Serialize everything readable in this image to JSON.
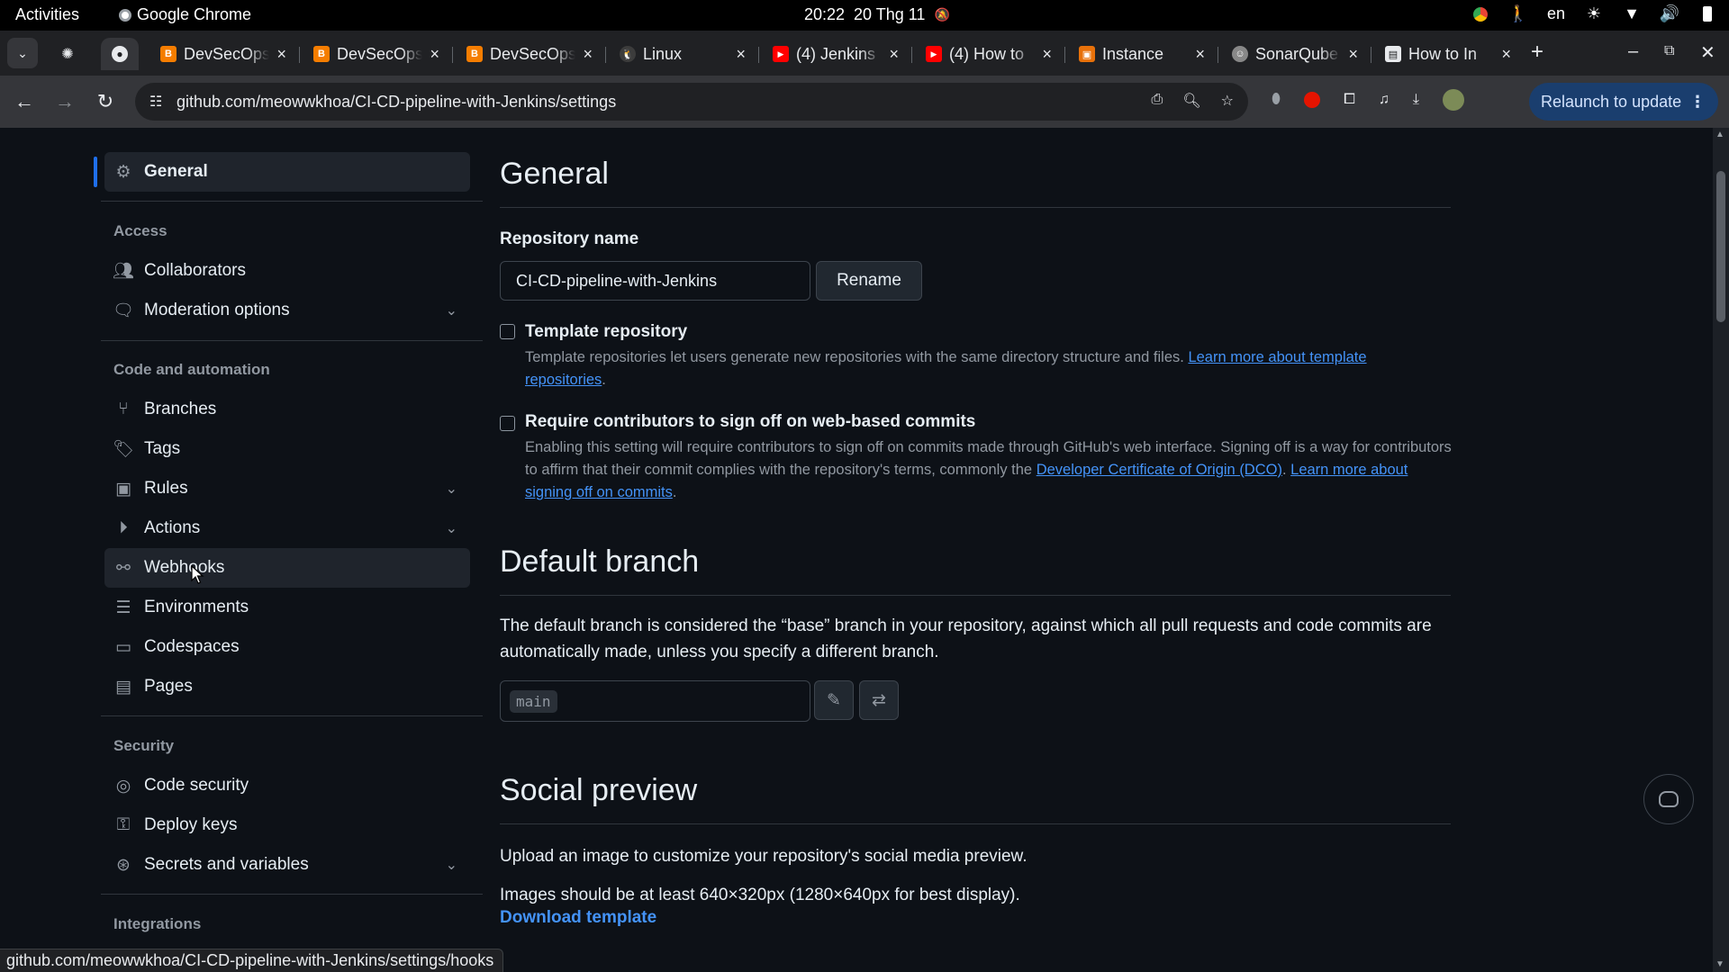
{
  "system": {
    "activities": "Activities",
    "app_name": "Google Chrome",
    "clock": "20:22",
    "date": "20 Thg 11",
    "language": "en"
  },
  "tabs": [
    {
      "title": "",
      "icon": "openai-icon",
      "color": "#202124"
    },
    {
      "title": "",
      "icon": "github-icon",
      "color": "#35363a",
      "active": true
    },
    {
      "title": "DevSecOps",
      "icon": "blogger-icon",
      "color": "#f57d00"
    },
    {
      "title": "DevSecOps",
      "icon": "blogger-icon",
      "color": "#f57d00"
    },
    {
      "title": "DevSecOps",
      "icon": "blogger-icon",
      "color": "#f57d00"
    },
    {
      "title": "Linux",
      "icon": "tux-icon",
      "color": "#444"
    },
    {
      "title": "(4) Jenkins",
      "icon": "youtube-icon",
      "color": "#ff0000"
    },
    {
      "title": "(4) How to",
      "icon": "youtube-icon",
      "color": "#ff0000"
    },
    {
      "title": "Instance",
      "icon": "aws-icon",
      "color": "#e8710a"
    },
    {
      "title": "SonarQube",
      "icon": "sonarqube-icon",
      "color": "#777"
    },
    {
      "title": "How to In",
      "icon": "page-icon",
      "color": "#e8eaed"
    }
  ],
  "toolbar": {
    "url": "github.com/meowwkhoa/CI-CD-pipeline-with-Jenkins/settings",
    "relaunch_label": "Relaunch to update"
  },
  "sidebar": {
    "general": "General",
    "sections": {
      "access": "Access",
      "code_automation": "Code and automation",
      "security": "Security",
      "integrations": "Integrations"
    },
    "items": {
      "collaborators": "Collaborators",
      "moderation": "Moderation options",
      "branches": "Branches",
      "tags": "Tags",
      "rules": "Rules",
      "actions": "Actions",
      "webhooks": "Webhooks",
      "environments": "Environments",
      "codespaces": "Codespaces",
      "pages": "Pages",
      "code_security": "Code security",
      "deploy_keys": "Deploy keys",
      "secrets": "Secrets and variables"
    }
  },
  "main": {
    "title": "General",
    "repo_name_label": "Repository name",
    "repo_name_value": "CI-CD-pipeline-with-Jenkins",
    "rename_button": "Rename",
    "template": {
      "label": "Template repository",
      "desc": "Template repositories let users generate new repositories with the same directory structure and files.",
      "link": "Learn more about template repositories",
      "checked": false
    },
    "signoff": {
      "label": "Require contributors to sign off on web-based commits",
      "desc_1": "Enabling this setting will require contributors to sign off on commits made through GitHub's web interface. Signing off is a way for contributors to affirm that their commit complies with the repository's terms, commonly the",
      "link_dco": "Developer Certificate of Origin (DCO)",
      "link_more": "Learn more about signing off on commits",
      "checked": false
    },
    "default_branch": {
      "title": "Default branch",
      "desc": "The default branch is considered the “base” branch in your repository, against which all pull requests and code commits are automatically made, unless you specify a different branch.",
      "value": "main"
    },
    "social_preview": {
      "title": "Social preview",
      "desc1": "Upload an image to customize your repository's social media preview.",
      "desc2": "Images should be at least 640×320px (1280×640px for best display).",
      "download": "Download template"
    }
  },
  "status_url": "github.com/meowwkhoa/CI-CD-pipeline-with-Jenkins/settings/hooks"
}
